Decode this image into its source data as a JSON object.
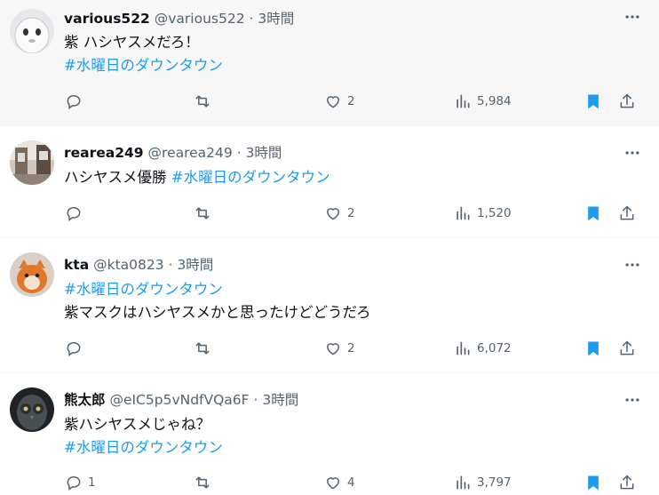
{
  "tweets": [
    {
      "name": "various522",
      "handle": "@various522",
      "time": "3時間",
      "text_plain": "紫 ハシヤスメだろ！",
      "hashtag": "#水曜日のダウンタウン",
      "replies": "",
      "likes": "2",
      "views": "5,984",
      "bookmarked": true
    },
    {
      "name": "rearea249",
      "handle": "@rearea249",
      "time": "3時間",
      "text_plain": "ハシヤスメ優勝",
      "hashtag": "#水曜日のダウンタウン",
      "replies": "",
      "likes": "2",
      "views": "1,520",
      "bookmarked": true
    },
    {
      "name": "kta",
      "handle": "@kta0823",
      "time": "3時間",
      "hashtag": "#水曜日のダウンタウン",
      "text_plain": "紫マスクはハシヤスメかと思ったけどどうだろ",
      "replies": "",
      "likes": "2",
      "views": "6,072",
      "bookmarked": true
    },
    {
      "name": "熊太郎",
      "handle": "@eIC5p5vNdfVQa6F",
      "time": "3時間",
      "text_plain": "紫ハシヤスメじゃね？",
      "hashtag": "#水曜日のダウンタウン",
      "replies": "1",
      "likes": "4",
      "views": "3,797",
      "bookmarked": true
    }
  ],
  "separator": "·",
  "colors": {
    "link": "#1d9bf0",
    "muted": "#536471",
    "hover_bg": "#f7f7f7"
  },
  "icons": [
    "reply-icon",
    "retweet-icon",
    "like-icon",
    "views-icon",
    "bookmark-icon",
    "share-icon",
    "more-icon"
  ]
}
